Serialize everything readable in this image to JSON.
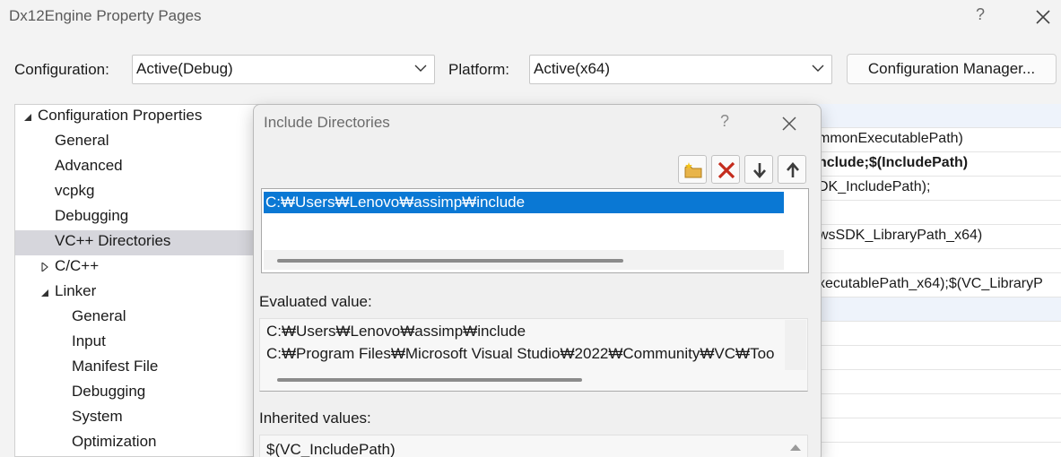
{
  "window": {
    "title": "Dx12Engine Property Pages",
    "help": "?"
  },
  "config": {
    "configuration_label": "Configuration:",
    "configuration_value": "Active(Debug)",
    "platform_label": "Platform:",
    "platform_value": "Active(x64)",
    "manager_button": "Configuration Manager..."
  },
  "tree": {
    "items": [
      {
        "label": "Configuration Properties",
        "expander": "expanded"
      },
      {
        "label": "General"
      },
      {
        "label": "Advanced"
      },
      {
        "label": "vcpkg"
      },
      {
        "label": "Debugging"
      },
      {
        "label": "VC++ Directories",
        "selected": true
      },
      {
        "label": "C/C++",
        "expander": "collapsed"
      },
      {
        "label": "Linker",
        "expander": "expanded"
      },
      {
        "label": "General"
      },
      {
        "label": "Input"
      },
      {
        "label": "Manifest File"
      },
      {
        "label": "Debugging"
      },
      {
        "label": "System"
      },
      {
        "label": "Optimization"
      }
    ]
  },
  "grid": {
    "rows": [
      "",
      "mmonExecutablePath)",
      "nclude;$(IncludePath)",
      "DK_IncludePath);",
      "",
      "wsSDK_LibraryPath_x64)",
      "",
      "xecutablePath_x64);$(VC_LibraryP",
      "",
      "",
      "",
      "",
      "",
      ""
    ]
  },
  "dialog": {
    "title": "Include Directories",
    "help": "?",
    "toolbar": {
      "new_line": "folder-add-icon",
      "delete": "delete-x-icon",
      "move_down": "arrow-down-icon",
      "move_up": "arrow-up-icon"
    },
    "list_items": [
      "C:₩Users₩Lenovo₩assimp₩include"
    ],
    "evaluated_label": "Evaluated value:",
    "evaluated_lines": [
      "C:₩Users₩Lenovo₩assimp₩include",
      "C:₩Program Files₩Microsoft Visual Studio₩2022₩Community₩VC₩Too"
    ],
    "inherited_label": "Inherited values:",
    "inherited_lines": [
      "$(VC_IncludePath)"
    ]
  },
  "colors": {
    "selection": "#0a78d4",
    "tree_selection": "#d6d6dc",
    "delete_icon": "#c42b1c"
  }
}
